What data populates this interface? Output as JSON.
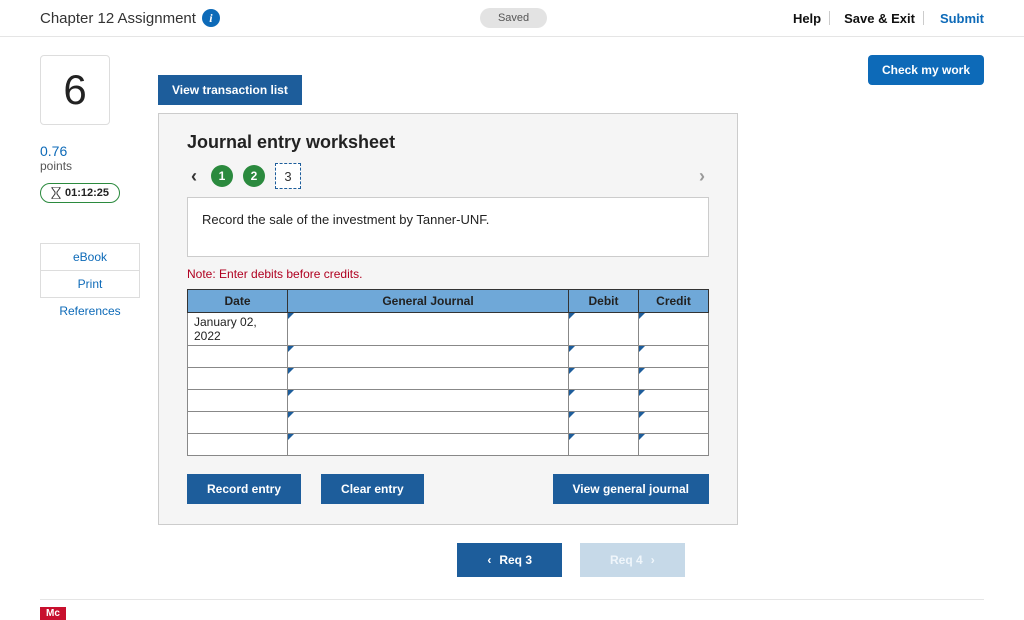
{
  "header": {
    "title": "Chapter 12 Assignment",
    "saved_label": "Saved",
    "help_label": "Help",
    "save_exit_label": "Save & Exit",
    "submit_label": "Submit"
  },
  "sidebar": {
    "question_number": "6",
    "points_value": "0.76",
    "points_label": "points",
    "timer": "01:12:25",
    "ebook_label": "eBook",
    "print_label": "Print",
    "references_label": "References"
  },
  "buttons": {
    "check_my_work": "Check my work",
    "view_transaction_list": "View transaction list",
    "record_entry": "Record entry",
    "clear_entry": "Clear entry",
    "view_general_journal": "View general journal"
  },
  "worksheet": {
    "title": "Journal entry worksheet",
    "steps": [
      "1",
      "2",
      "3"
    ],
    "current_step": "3",
    "instruction": "Record the sale of the investment by Tanner-UNF.",
    "note": "Note: Enter debits before credits.",
    "columns": {
      "date": "Date",
      "general_journal": "General Journal",
      "debit": "Debit",
      "credit": "Credit"
    },
    "rows": [
      {
        "date": "January 02, 2022",
        "gj": "",
        "debit": "",
        "credit": ""
      },
      {
        "date": "",
        "gj": "",
        "debit": "",
        "credit": ""
      },
      {
        "date": "",
        "gj": "",
        "debit": "",
        "credit": ""
      },
      {
        "date": "",
        "gj": "",
        "debit": "",
        "credit": ""
      },
      {
        "date": "",
        "gj": "",
        "debit": "",
        "credit": ""
      },
      {
        "date": "",
        "gj": "",
        "debit": "",
        "credit": ""
      }
    ]
  },
  "bottom_nav": {
    "prev_label": "Req 3",
    "next_label": "Req 4"
  },
  "footer_tag": "Mc"
}
